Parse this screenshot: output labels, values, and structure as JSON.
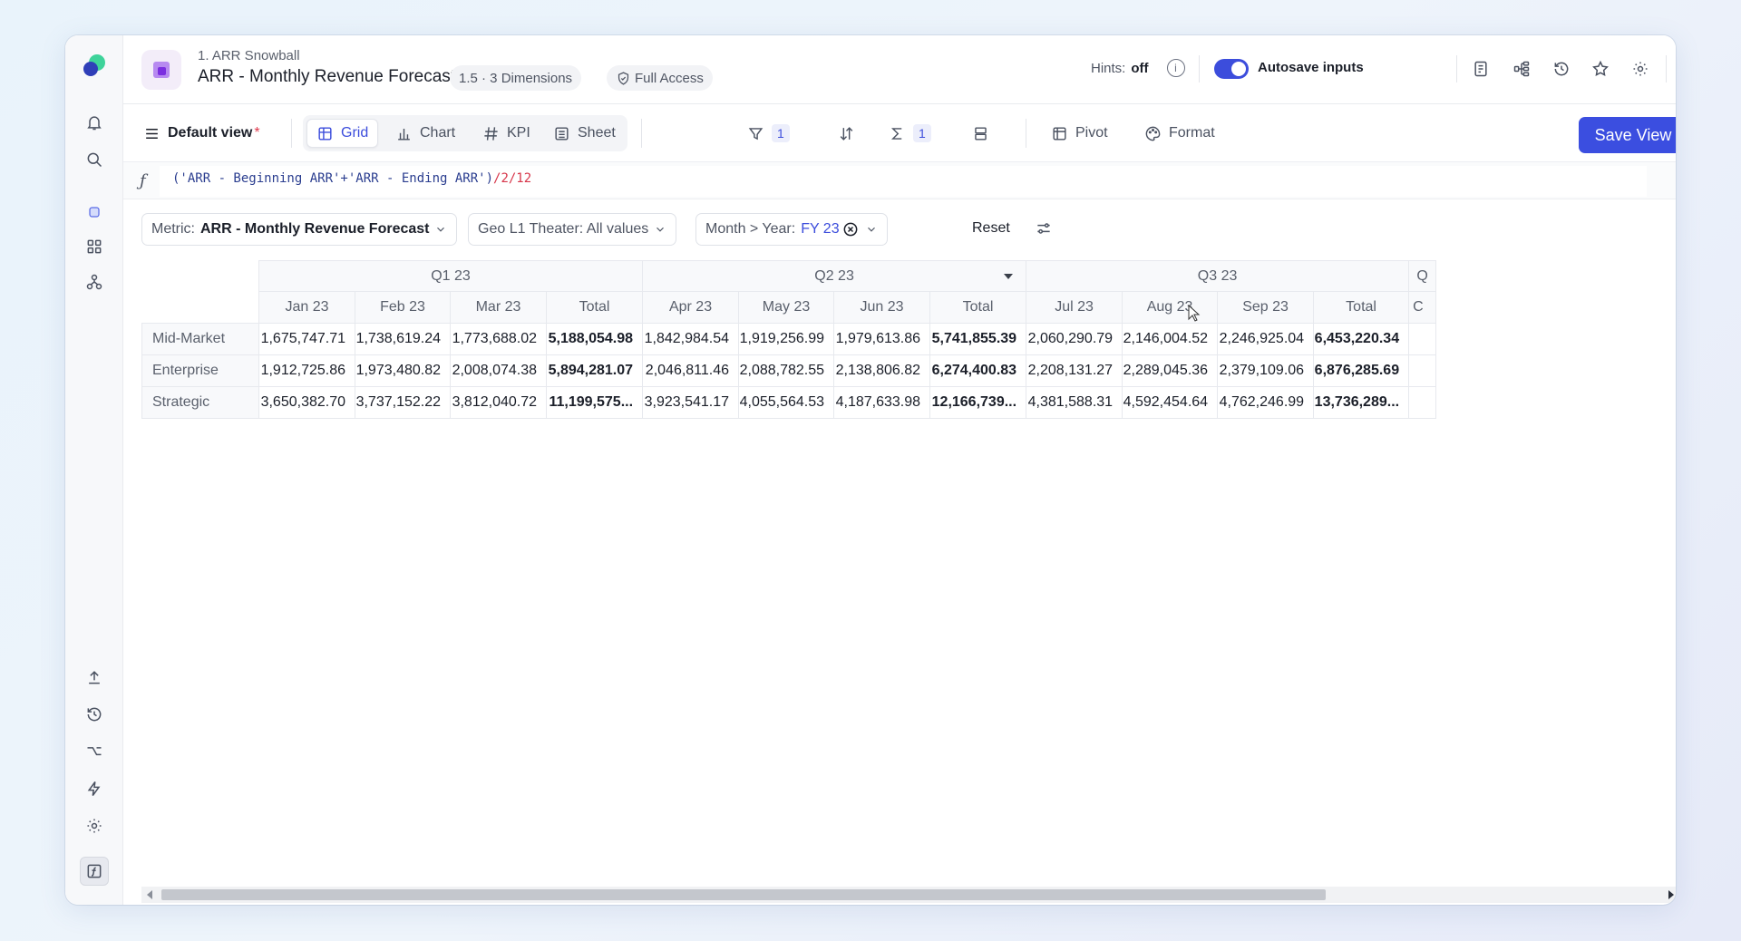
{
  "header": {
    "breadcrumb": "1. ARR Snowball",
    "title": "ARR - Monthly Revenue Forecast",
    "version_dims": "1.5 · 3 Dimensions",
    "access": "Full Access",
    "hints_label": "Hints:",
    "hints_value": "off",
    "autosave_label": "Autosave inputs",
    "autosave_on": true
  },
  "toolbar": {
    "view_name": "Default view",
    "view_modified": "*",
    "grid": "Grid",
    "chart": "Chart",
    "kpi": "KPI",
    "sheet": "Sheet",
    "filter_count": "1",
    "aggregate_count": "1",
    "pivot": "Pivot",
    "format": "Format",
    "save_view": "Save View"
  },
  "formula": {
    "part1": "('ARR - Beginning ARR'+'ARR - Ending ARR')",
    "part2": "/2/12"
  },
  "filters": {
    "metric_label": "Metric:",
    "metric_value": "ARR - Monthly Revenue Forecast",
    "geo": "Geo L1 Theater: All values",
    "month_label": "Month > Year:",
    "month_value": "FY 23",
    "reset": "Reset"
  },
  "grid": {
    "quarters": [
      "Q1 23",
      "Q2 23",
      "Q3 23",
      "Q"
    ],
    "months": [
      "Jan 23",
      "Feb 23",
      "Mar 23",
      "Total",
      "Apr 23",
      "May 23",
      "Jun 23",
      "Total",
      "Jul 23",
      "Aug 23",
      "Sep 23",
      "Total",
      "C"
    ],
    "rows": [
      {
        "label": "Mid-Market",
        "values": [
          "1,675,747.71",
          "1,738,619.24",
          "1,773,688.02",
          "5,188,054.98",
          "1,842,984.54",
          "1,919,256.99",
          "1,979,613.86",
          "5,741,855.39",
          "2,060,290.79",
          "2,146,004.52",
          "2,246,925.04",
          "6,453,220.34",
          ""
        ]
      },
      {
        "label": "Enterprise",
        "values": [
          "1,912,725.86",
          "1,973,480.82",
          "2,008,074.38",
          "5,894,281.07",
          "2,046,811.46",
          "2,088,782.55",
          "2,138,806.82",
          "6,274,400.83",
          "2,208,131.27",
          "2,289,045.36",
          "2,379,109.06",
          "6,876,285.69",
          ""
        ]
      },
      {
        "label": "Strategic",
        "values": [
          "3,650,382.70",
          "3,737,152.22",
          "3,812,040.72",
          "11,199,575...",
          "3,923,541.17",
          "4,055,564.53",
          "4,187,633.98",
          "12,166,739...",
          "4,381,588.31",
          "4,592,454.64",
          "4,762,246.99",
          "13,736,289...",
          ""
        ]
      }
    ]
  },
  "colors": {
    "accent": "#3b4ee0",
    "toggle_on": "#3c4ddc",
    "formula_number": "#d7364a"
  }
}
